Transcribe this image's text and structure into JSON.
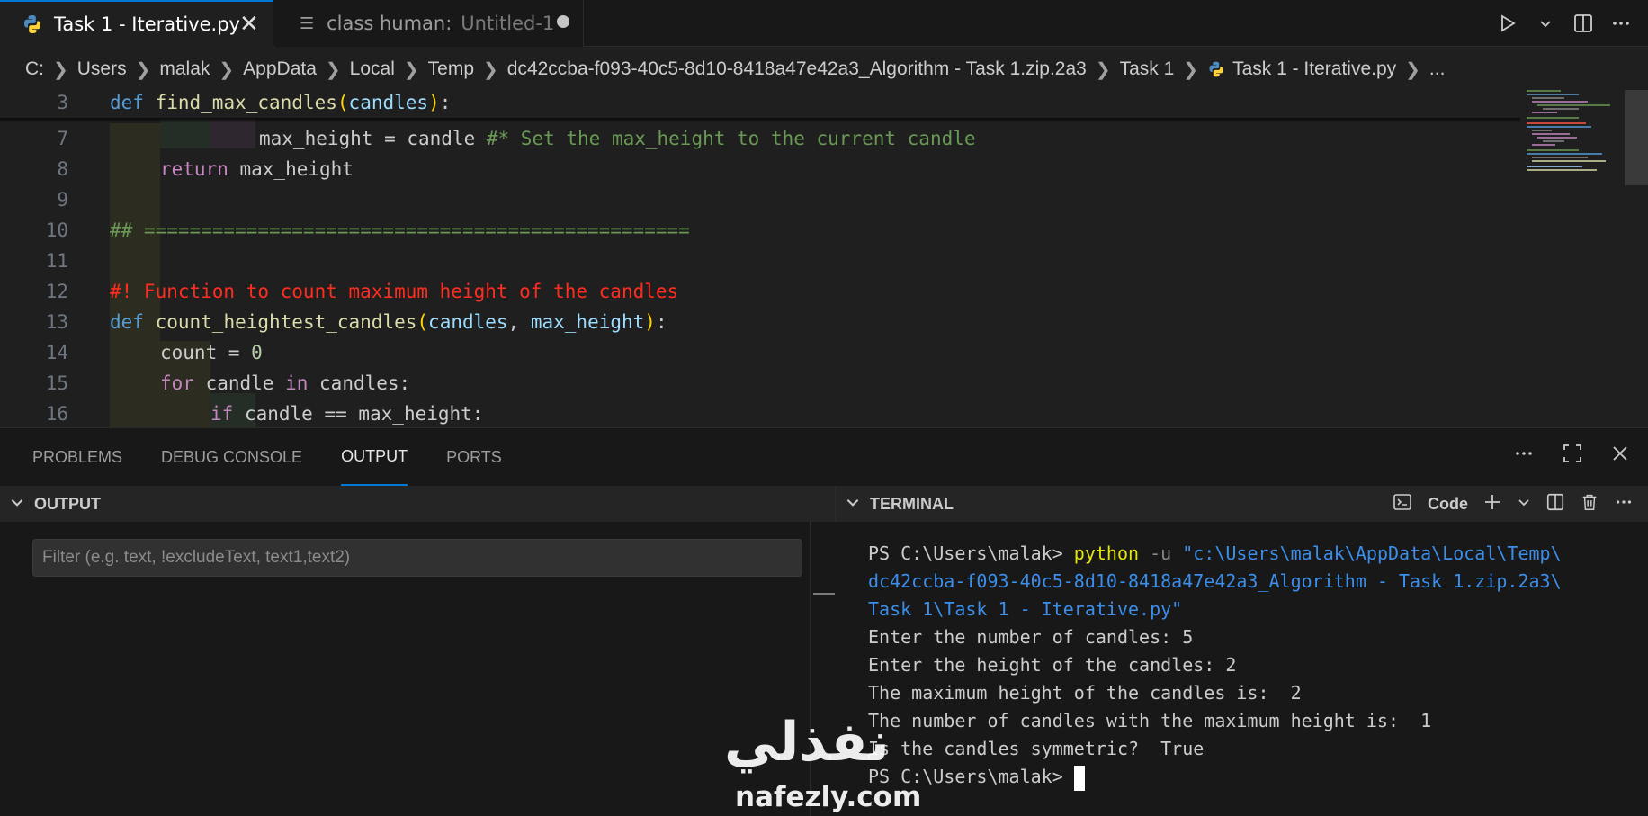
{
  "tabs": [
    {
      "label": "Task 1 - Iterative.py",
      "close": "✕"
    },
    {
      "label": "class human:",
      "description": "Untitled-1"
    }
  ],
  "breadcrumb": [
    "C:",
    "Users",
    "malak",
    "AppData",
    "Local",
    "Temp",
    "dc42ccba-f093-40c5-8d10-8418a47e42a3_Algorithm - Task 1.zip.2a3",
    "Task 1",
    "Task 1 - Iterative.py",
    "..."
  ],
  "editor": {
    "line_numbers": [
      "3",
      "7",
      "8",
      "9",
      "10",
      "11",
      "12",
      "13",
      "14",
      "15",
      "16"
    ],
    "l3": {
      "kw": "def",
      "fn": "find_max_candles",
      "open": "(",
      "param": "candles",
      "close": ")",
      "colon": ":"
    },
    "l7": {
      "code": "max_height = candle ",
      "comment": "#* Set the max_height to the current candle"
    },
    "l8": {
      "kw": "return",
      "code": " max_height"
    },
    "l10": {
      "comment": "## ================================================"
    },
    "l12": {
      "comment": "#! Function to count maximum height of the candles"
    },
    "l13": {
      "kw": "def",
      "fn": "count_heightest_candles",
      "open": "(",
      "param1": "candles",
      "sep": ", ",
      "param2": "max_height",
      "close": ")",
      "colon": ":"
    },
    "l14": {
      "code": "count = ",
      "num": "0"
    },
    "l15": {
      "kw1": "for",
      "mid": " candle ",
      "kw2": "in",
      "rest": " candles:"
    },
    "l16": {
      "kw": "if",
      "code": " candle == max_height:"
    }
  },
  "panel": {
    "tabs": [
      "PROBLEMS",
      "DEBUG CONSOLE",
      "OUTPUT",
      "PORTS"
    ],
    "active_tab": "OUTPUT",
    "output_header": "OUTPUT",
    "filter_placeholder": "Filter (e.g. text, !excludeText, text1,text2)",
    "terminal_header": "TERMINAL",
    "terminal_profile": "Code"
  },
  "terminal": {
    "prompt1": "PS C:\\Users\\malak> ",
    "cmd": "python",
    "flag": " -u ",
    "path1": "\"c:\\Users\\malak\\AppData\\Local\\Temp\\",
    "path2": "dc42ccba-f093-40c5-8d10-8418a47e42a3_Algorithm - Task 1.zip.2a3\\",
    "path3": "Task 1\\Task 1 - Iterative.py\"",
    "out1": "Enter the number of candles: 5",
    "out2": "Enter the height of the candles: 2",
    "out3": "The maximum height of the candles is:  2",
    "out4": "The number of candles with the maximum height is:  1",
    "out5": "Is the candles symmetric?  True",
    "prompt2": "PS C:\\Users\\malak> "
  },
  "watermark": {
    "arabic": "نفذلي",
    "latin": "nafezly.com"
  },
  "colors": {
    "accent": "#0078d4",
    "editor_bg": "#1f1f1f",
    "panel_bg": "#181818"
  }
}
